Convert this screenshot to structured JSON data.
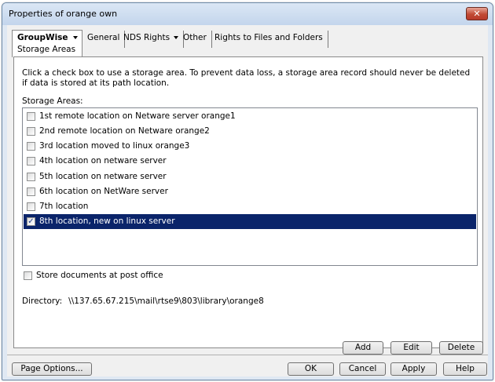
{
  "window": {
    "title": "Properties of orange own",
    "close_glyph": "✕"
  },
  "tabs": {
    "active": {
      "label": "GroupWise",
      "subtab": "Storage Areas"
    },
    "others": [
      "General",
      "NDS Rights",
      "Other",
      "Rights to Files and Folders"
    ]
  },
  "panel": {
    "description": "Click a check box to use a storage area.  To prevent data loss, a storage area record should never be deleted if data is stored at its path location.",
    "storage_label": "Storage Areas:",
    "storage_areas": [
      {
        "label": "1st remote location on Netware server orange1",
        "checked": false
      },
      {
        "label": "2nd remote location on Netware orange2",
        "checked": false
      },
      {
        "label": "3rd location moved to linux orange3",
        "checked": false
      },
      {
        "label": "4th location on netware server",
        "checked": false
      },
      {
        "label": "5th location on netware server",
        "checked": false
      },
      {
        "label": "6th location on NetWare server",
        "checked": false
      },
      {
        "label": "7th location",
        "checked": false
      },
      {
        "label": "8th location, new on linux server",
        "checked": true
      }
    ],
    "store_docs_label": "Store documents at post office",
    "directory_label": "Directory:",
    "directory_value": "\\\\137.65.67.215\\mail\\rtse9\\803\\library\\orange8",
    "buttons": {
      "add": "Add",
      "edit": "Edit",
      "delete": "Delete"
    }
  },
  "footer": {
    "page_options": "Page Options...",
    "ok": "OK",
    "cancel": "Cancel",
    "apply": "Apply",
    "help": "Help"
  },
  "colors": {
    "selection": "#0a246a",
    "close": "#c14a34"
  }
}
